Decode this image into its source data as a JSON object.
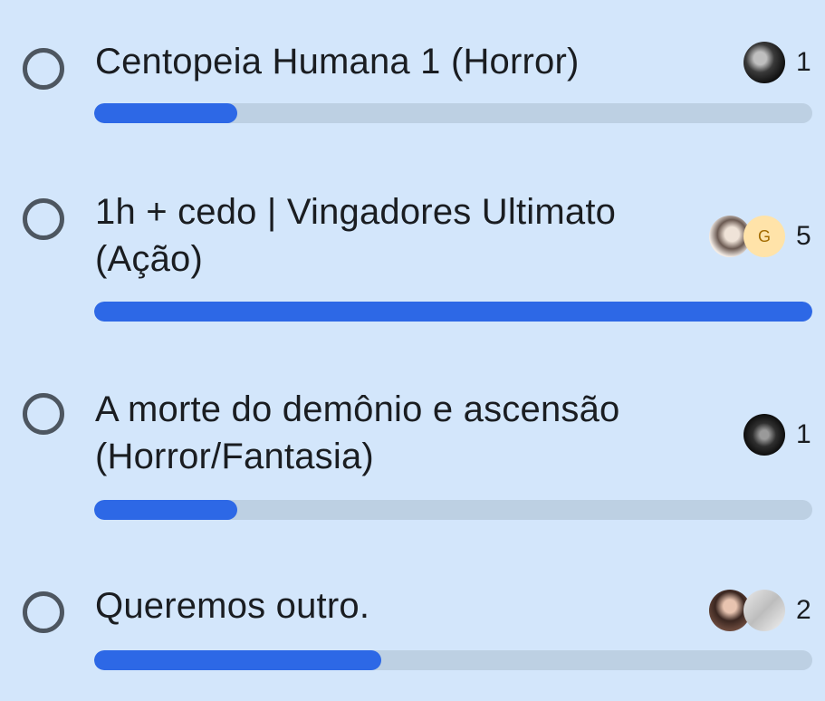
{
  "poll": {
    "options": [
      {
        "label": "Centopeia Humana 1 (Horror)",
        "votes": "1",
        "fraction": 0.2,
        "avatars": [
          "photo-dark"
        ]
      },
      {
        "label_line1": "1h + cedo | Vingadores Ultimato",
        "label_line2": "(Ação)",
        "votes": "5",
        "fraction": 1.0,
        "avatars": [
          "photo-anime",
          "G"
        ]
      },
      {
        "label_line1": "A morte do demônio e ascensão",
        "label_line2": "(Horror/Fantasia)",
        "votes": "1",
        "fraction": 0.2,
        "avatars": [
          "photo-dark"
        ]
      },
      {
        "label": "Queremos outro.",
        "votes": "2",
        "fraction": 0.4,
        "avatars": [
          "photo-person",
          "photo-light"
        ]
      }
    ]
  },
  "colors": {
    "background": "#d3e6fb",
    "bar_fill": "#2d68e6",
    "bar_track": "#bdd0e3",
    "radio": "#4d5660",
    "letter_avatar_bg": "#ffe3a9"
  }
}
